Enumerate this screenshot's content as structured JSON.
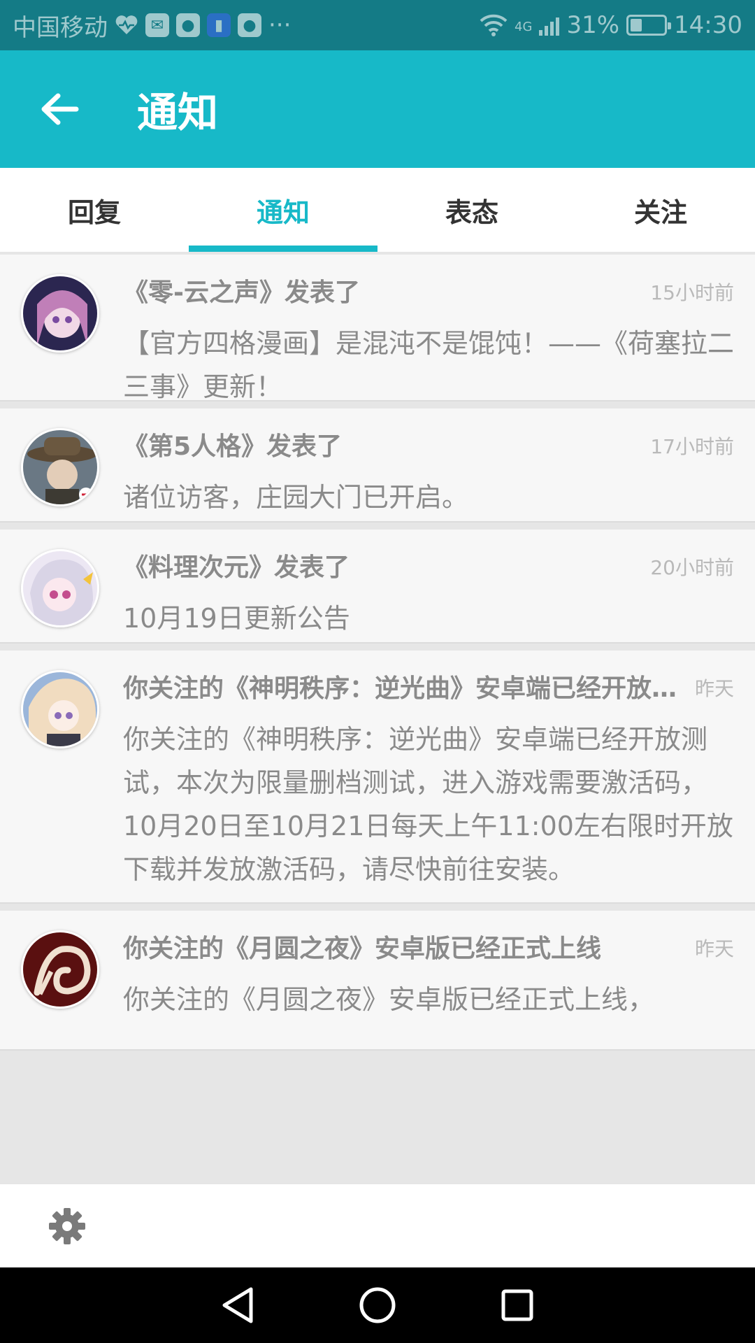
{
  "status_bar": {
    "carrier": "中国移动",
    "more": "···",
    "network": "4G",
    "battery": "31%",
    "battery_level": 0.31,
    "time": "14:30"
  },
  "app_bar": {
    "title": "通知"
  },
  "tabs": [
    {
      "label": "回复",
      "active": false
    },
    {
      "label": "通知",
      "active": true
    },
    {
      "label": "表态",
      "active": false
    },
    {
      "label": "关注",
      "active": false
    }
  ],
  "notifications": [
    {
      "title": "《零-云之声》发表了",
      "time": "15小时前",
      "body": "【官方四格漫画】是混沌不是馄饨！——《荷塞拉二三事》更新！",
      "avatar_colors": [
        "#2b2650",
        "#c07fb8"
      ]
    },
    {
      "title": "《第5人格》发表了",
      "time": "17小时前",
      "body": "诸位访客，庄园大门已开启。",
      "avatar_colors": [
        "#3d3a33",
        "#8b7a5c"
      ]
    },
    {
      "title": "《料理次元》发表了",
      "time": "20小时前",
      "body": "10月19日更新公告",
      "avatar_colors": [
        "#e9e4f0",
        "#d38fb8"
      ]
    },
    {
      "title": "你关注的《神明秩序：逆光曲》安卓端已经开放测试，本次为限量删档测试，进入游戏需要激活码，10月20日至10月21日每天上午11:00左右限时开放下载并发放激活码，请尽快前往安装。",
      "time": "昨天",
      "body": "你关注的《神明秩序：逆光曲》安卓端已经开放测试，本次为限量删档测试，进入游戏需要激活码，10月20日至10月21日每天上午11:00左右限时开放下载并发放激活码，请尽快前往安装。",
      "avatar_colors": [
        "#f1dcc0",
        "#8aa3c9"
      ]
    },
    {
      "title": "你关注的《月圆之夜》安卓版已经正式上线",
      "time": "昨天",
      "body": "你关注的《月圆之夜》安卓版已经正式上线，",
      "avatar_colors": [
        "#5a1010",
        "#f0e0d0"
      ]
    }
  ],
  "colors": {
    "primary": "#17b9c8",
    "status_bar": "#147b86",
    "text_gray": "#8a8a8a"
  },
  "icons": {
    "back": "arrow-left-icon",
    "settings": "gear-icon",
    "nav_back": "triangle-back-icon",
    "nav_home": "circle-home-icon",
    "nav_recent": "square-recent-icon"
  }
}
